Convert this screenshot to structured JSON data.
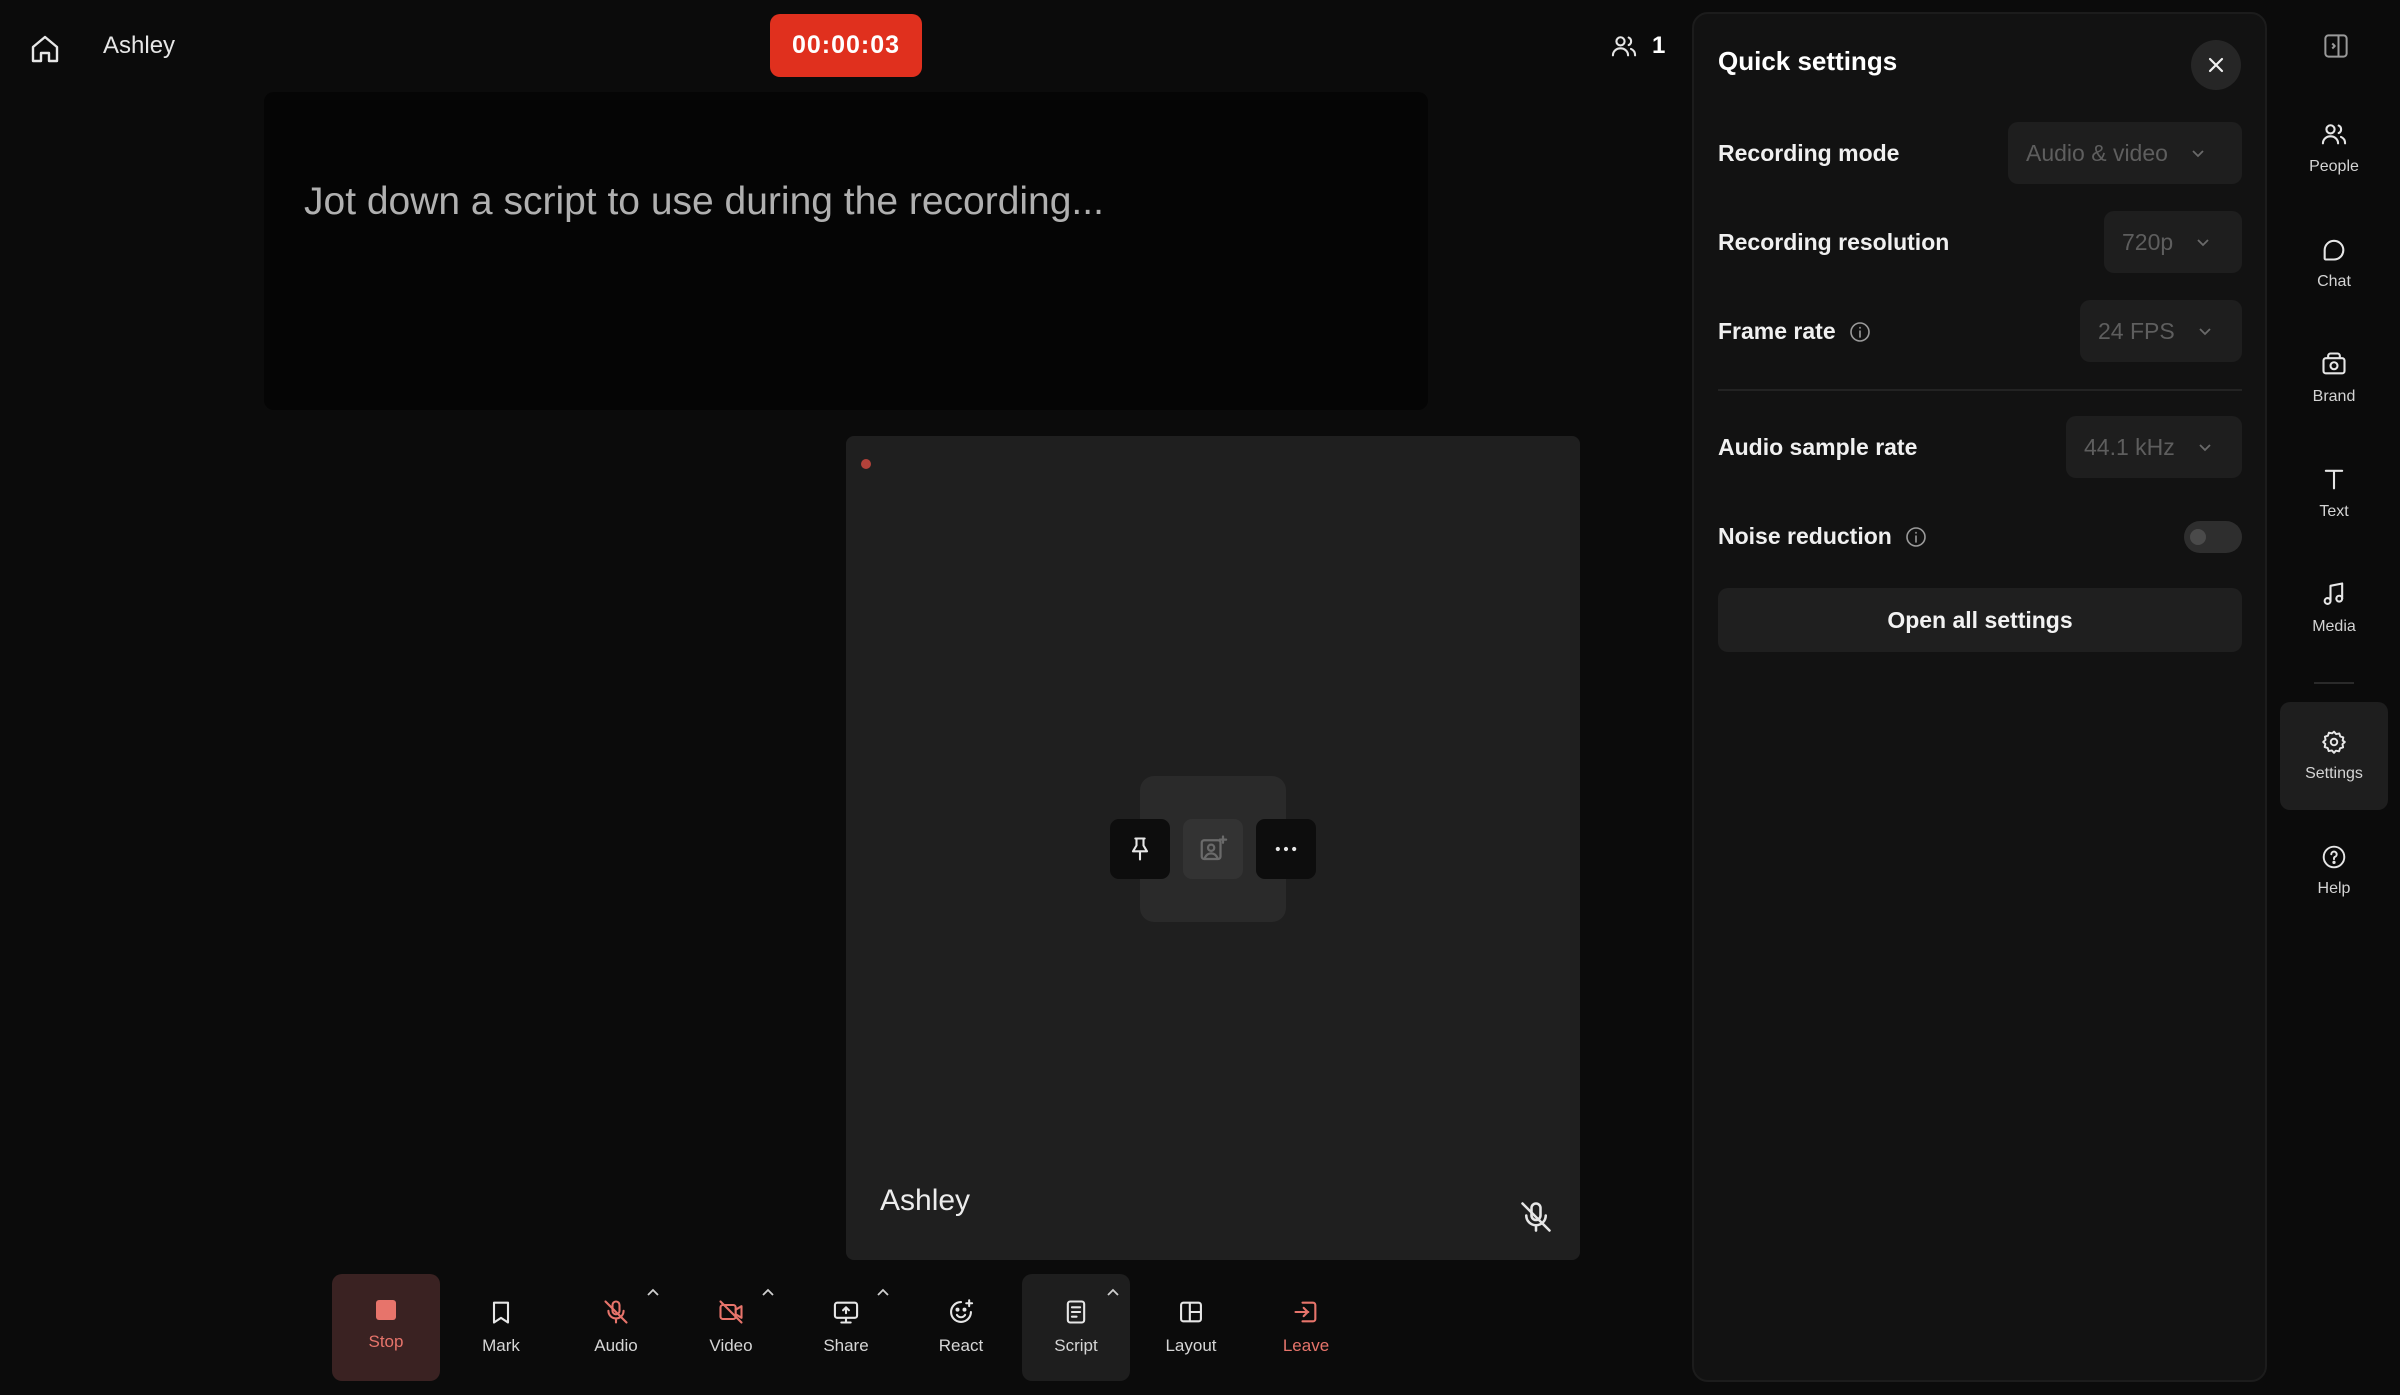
{
  "header": {
    "session_name": "Ashley",
    "timer": "00:00:03",
    "participant_count": "1"
  },
  "script": {
    "placeholder": "Jot down a script to use during the recording..."
  },
  "tile": {
    "participant_name": "Ashley"
  },
  "toolbar": {
    "items": [
      {
        "label": "Stop",
        "icon": "stop-icon"
      },
      {
        "label": "Mark",
        "icon": "bookmark-icon"
      },
      {
        "label": "Audio",
        "icon": "mic-off-icon"
      },
      {
        "label": "Video",
        "icon": "camera-off-icon"
      },
      {
        "label": "Share",
        "icon": "screen-share-icon"
      },
      {
        "label": "React",
        "icon": "emoji-icon"
      },
      {
        "label": "Script",
        "icon": "script-icon"
      },
      {
        "label": "Layout",
        "icon": "layout-icon"
      },
      {
        "label": "Leave",
        "icon": "leave-icon"
      }
    ]
  },
  "quick_settings": {
    "title": "Quick settings",
    "recording_mode": {
      "label": "Recording mode",
      "value": "Audio & video"
    },
    "recording_resolution": {
      "label": "Recording resolution",
      "value": "720p"
    },
    "frame_rate": {
      "label": "Frame rate",
      "value": "24 FPS"
    },
    "audio_sample_rate": {
      "label": "Audio sample rate",
      "value": "44.1 kHz"
    },
    "noise_reduction": {
      "label": "Noise reduction",
      "enabled": false
    },
    "open_all_label": "Open all settings"
  },
  "rail": {
    "items": [
      {
        "label": "People",
        "icon": "people-icon"
      },
      {
        "label": "Chat",
        "icon": "chat-icon"
      },
      {
        "label": "Brand",
        "icon": "brand-icon"
      },
      {
        "label": "Text",
        "icon": "text-icon"
      },
      {
        "label": "Media",
        "icon": "music-icon"
      },
      {
        "label": "Settings",
        "icon": "gear-icon"
      },
      {
        "label": "Help",
        "icon": "help-icon"
      }
    ]
  },
  "colors": {
    "background": "#0b0b0b",
    "timer_red": "#e0301e",
    "stop_accent": "#e7746b",
    "panel": "#121212"
  }
}
